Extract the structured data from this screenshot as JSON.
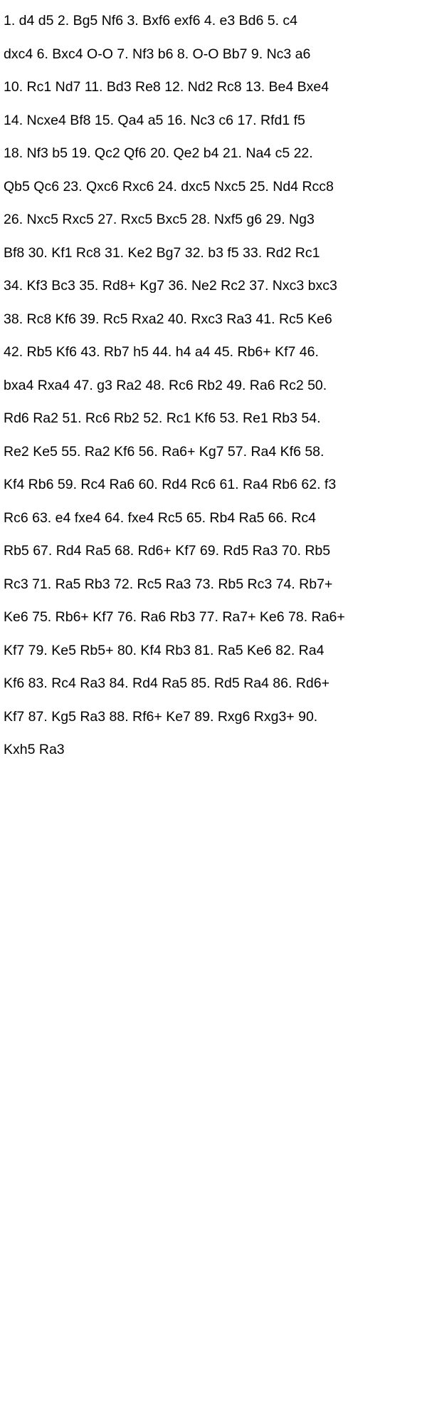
{
  "document": {
    "lines": [
      "1. d4 d5 2. Bg5 Nf6 3. Bxf6 exf6 4. e3 Bd6 5. c4",
      "dxc4 6. Bxc4 O-O 7. Nf3 b6 8. O-O Bb7 9. Nc3 a6",
      "10. Rc1 Nd7 11. Bd3 Re8 12. Nd2 Rc8 13. Be4 Bxe4",
      "14. Ncxe4 Bf8 15. Qa4 a5 16. Nc3 c6 17. Rfd1 f5",
      "18. Nf3 b5 19. Qc2 Qf6 20. Qe2 b4 21. Na4 c5 22.",
      "Qb5 Qc6 23. Qxc6 Rxc6 24. dxc5 Nxc5 25. Nd4 Rcc8",
      "26. Nxc5 Rxc5 27. Rxc5 Bxc5 28. Nxf5 g6 29. Ng3",
      "Bf8 30. Kf1 Rc8 31. Ke2 Bg7 32. b3 f5 33. Rd2 Rc1",
      "34. Kf3 Bc3 35. Rd8+ Kg7 36. Ne2 Rc2 37. Nxc3 bxc3",
      "38. Rc8 Kf6 39. Rc5 Rxa2 40. Rxc3 Ra3 41. Rc5 Ke6",
      "42. Rb5 Kf6 43. Rb7 h5 44. h4 a4 45. Rb6+ Kf7 46.",
      "bxa4 Rxa4 47. g3 Ra2 48. Rc6 Rb2 49. Ra6 Rc2 50.",
      "Rd6 Ra2 51. Rc6 Rb2 52. Rc1 Kf6 53. Re1 Rb3 54.",
      "Re2 Ke5 55. Ra2 Kf6 56. Ra6+ Kg7 57. Ra4 Kf6 58.",
      "Kf4 Rb6 59. Rc4 Ra6 60. Rd4 Rc6 61. Ra4 Rb6 62. f3",
      "Rc6 63. e4 fxe4 64. fxe4 Rc5 65. Rb4 Ra5 66. Rc4",
      "Rb5 67. Rd4 Ra5 68. Rd6+ Kf7 69. Rd5 Ra3 70. Rb5",
      "Rc3 71. Ra5 Rb3 72. Rc5 Ra3 73. Rb5 Rc3 74. Rb7+",
      "Ke6 75. Rb6+ Kf7 76. Ra6 Rb3 77. Ra7+ Ke6 78. Ra6+",
      "Kf7 79. Ke5 Rb5+ 80. Kf4 Rb3 81. Ra5 Ke6 82. Ra4",
      "Kf6 83. Rc4 Ra3 84. Rd4 Ra5 85. Rd5 Ra4 86. Rd6+",
      "Kf7 87. Kg5 Ra3 88. Rf6+ Ke7 89. Rxg6 Rxg3+ 90.",
      "Kxh5 Ra3"
    ]
  }
}
